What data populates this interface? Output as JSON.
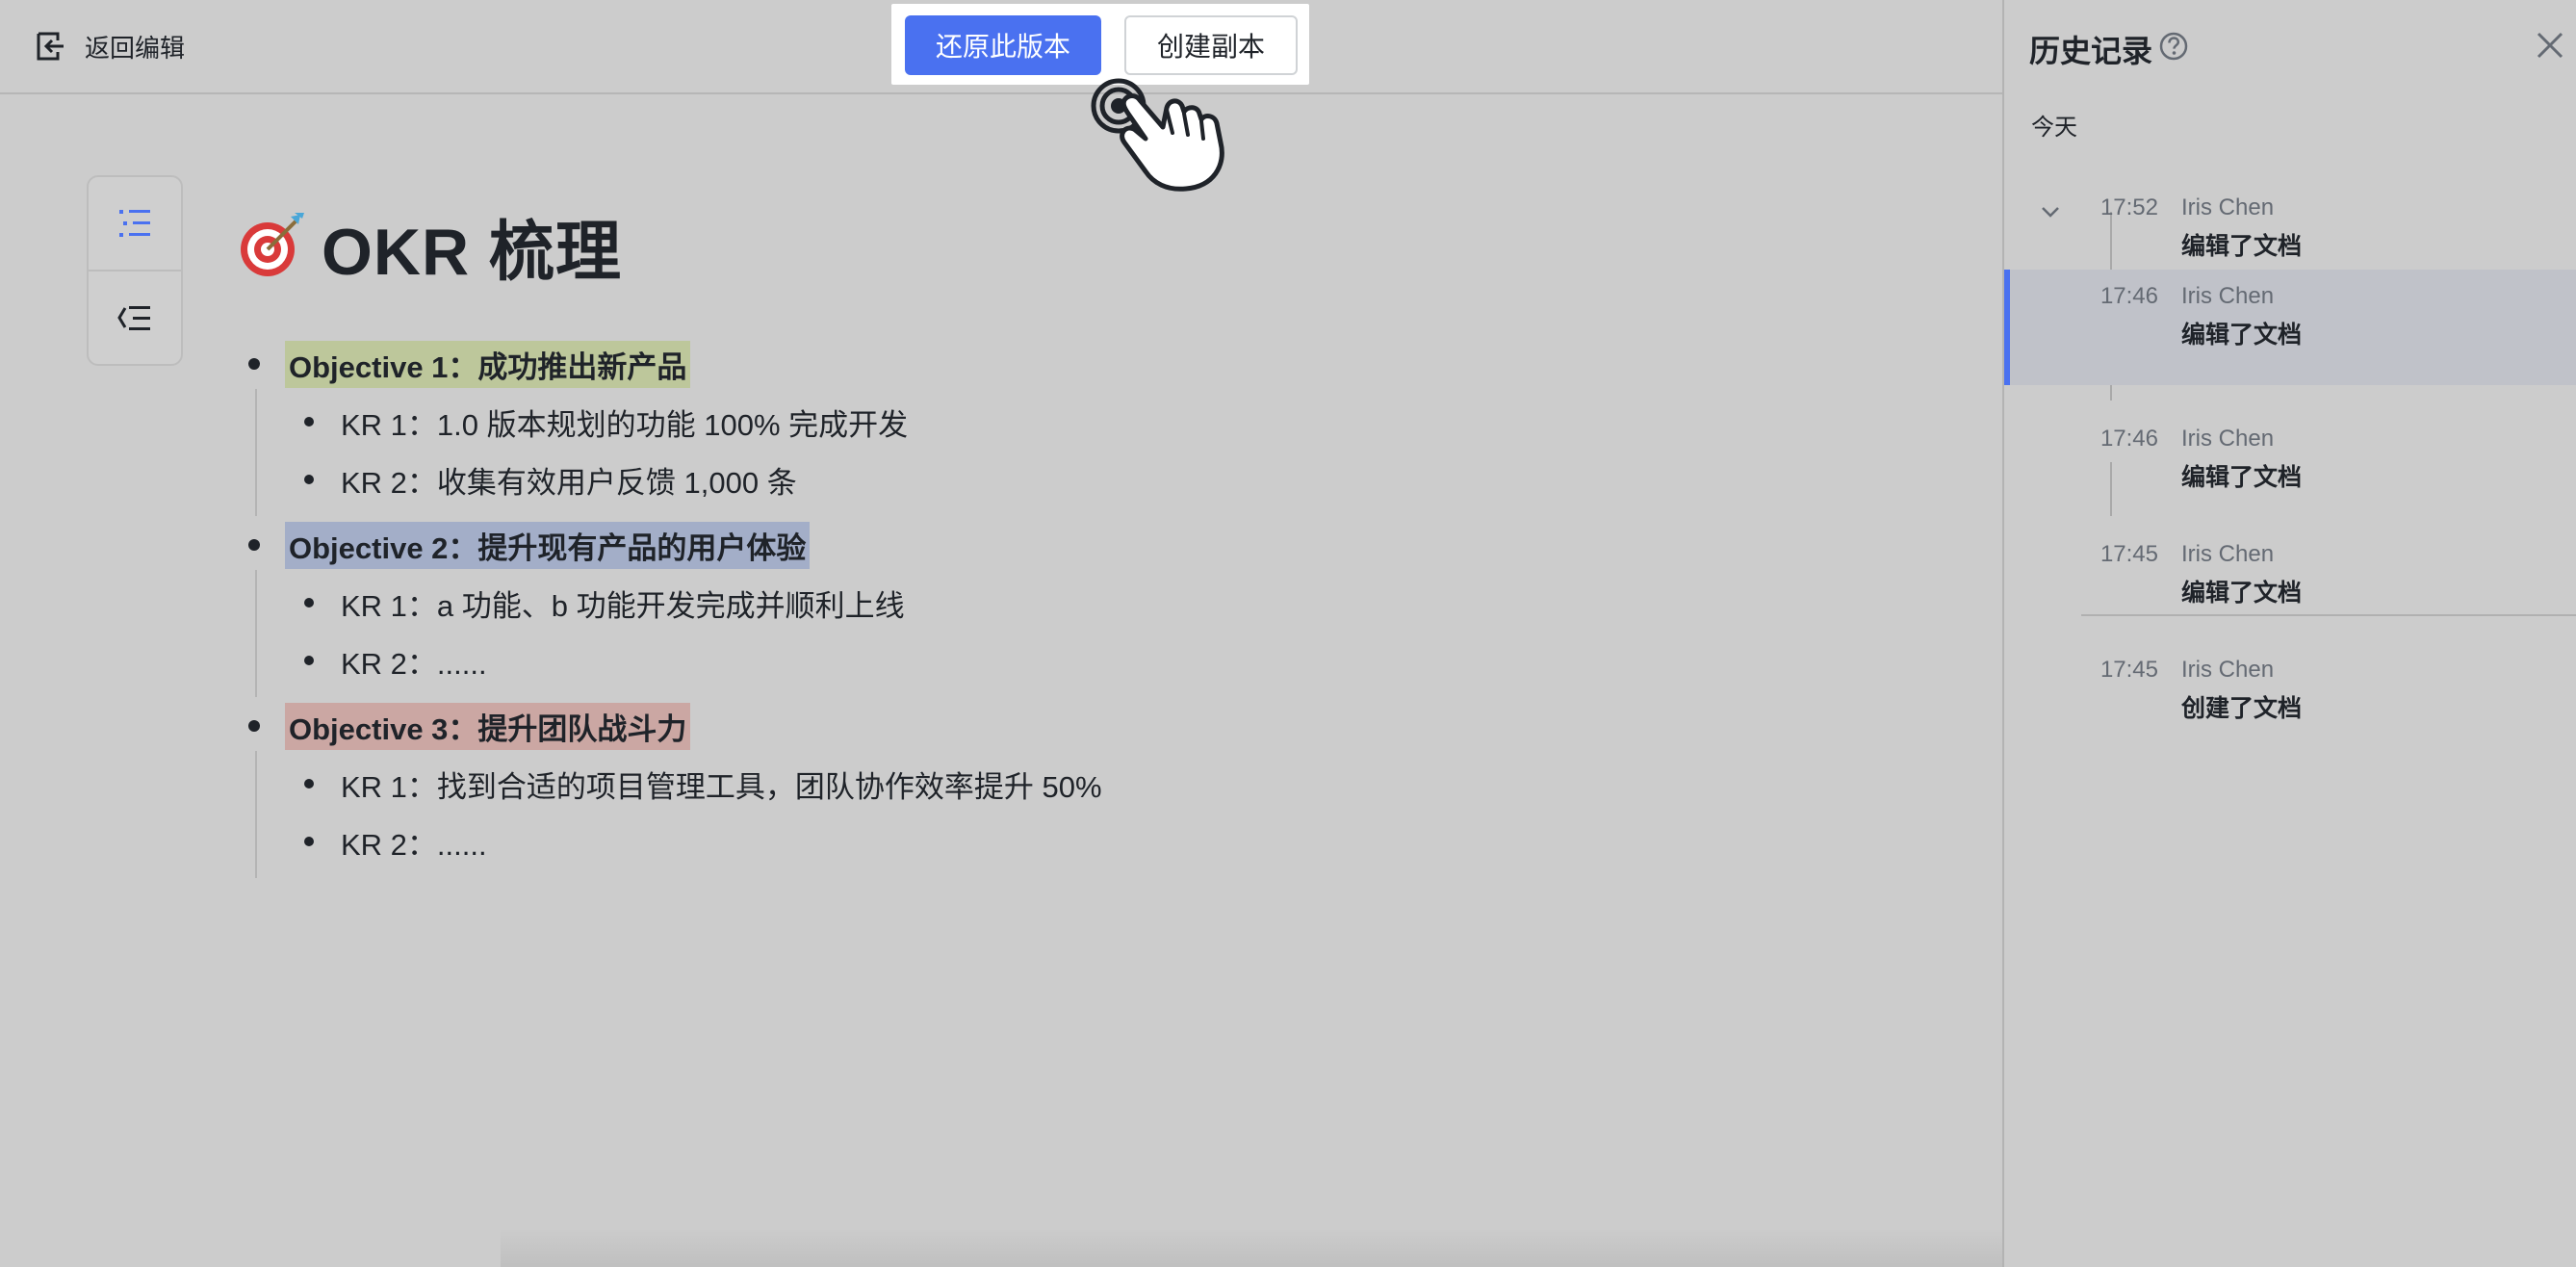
{
  "topbar": {
    "back_label": "返回编辑",
    "restore_label": "还原此版本",
    "copy_label": "创建副本"
  },
  "document": {
    "title": "OKR 梳理",
    "title_emoji": "target-icon",
    "objectives": [
      {
        "label": "Objective 1：成功推出新产品",
        "highlight": "#bdc79b",
        "krs": [
          "KR 1：1.0 版本规划的功能 100% 完成开发",
          "KR 2：收集有效用户反馈  1,000 条"
        ]
      },
      {
        "label": "Objective 2：提升现有产品的用户体验",
        "highlight": "#a3aec8",
        "krs": [
          "KR 1：a 功能、b 功能开发完成并顺利上线",
          "KR 2：......"
        ]
      },
      {
        "label": "Objective 3：提升团队战斗力",
        "highlight": "#cba7a3",
        "krs": [
          "KR 1：找到合适的项目管理工具，团队协作效率提升 50%",
          "KR 2：......"
        ]
      }
    ]
  },
  "history": {
    "title": "历史记录",
    "section": "今天",
    "entries": [
      {
        "time": "17:52",
        "user": "Iris Chen",
        "action": "编辑了文档"
      },
      {
        "time": "17:46",
        "user": "Iris Chen",
        "action": "编辑了文档"
      },
      {
        "time": "17:46",
        "user": "Iris Chen",
        "action": "编辑了文档"
      },
      {
        "time": "17:45",
        "user": "Iris Chen",
        "action": "编辑了文档"
      },
      {
        "time": "17:45",
        "user": "Iris Chen",
        "action": "创建了文档"
      }
    ]
  },
  "colors": {
    "accent": "#4a71f0"
  }
}
